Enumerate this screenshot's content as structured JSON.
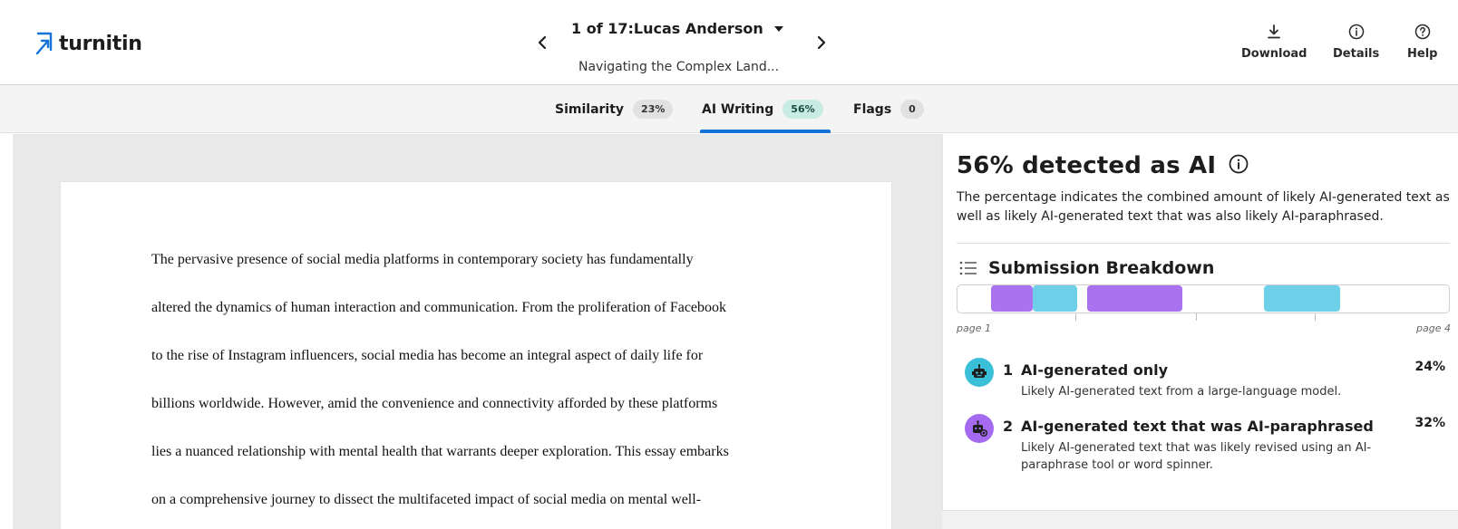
{
  "header": {
    "logo_text": "turnitin",
    "submission_title": "1 of 17:Lucas Anderson",
    "document_title": "Navigating the Complex Land...",
    "download_label": "Download",
    "details_label": "Details",
    "help_label": "Help",
    "brand_color": "#1572d6"
  },
  "tabs": [
    {
      "label": "Similarity",
      "badge": "23%"
    },
    {
      "label": "AI Writing",
      "badge": "56%",
      "active": true
    },
    {
      "label": "Flags",
      "badge": "0"
    }
  ],
  "document": {
    "lines": [
      "The pervasive presence of social media platforms in contemporary society has fundamentally",
      "altered the dynamics of human interaction and communication. From the proliferation of Facebook",
      "to the rise of Instagram influencers, social media has become an integral aspect of daily life for",
      "billions worldwide. However, amid the convenience and connectivity afforded by these platforms",
      "lies a nuanced relationship with mental health that warrants deeper exploration. This essay embarks",
      "on a comprehensive journey to dissect the multifaceted impact of social media on mental well-"
    ]
  },
  "panel": {
    "title": "56% detected as AI",
    "description": "The percentage indicates the combined amount of likely AI-generated text as well as likely AI-generated text that was also likely AI-paraphrased.",
    "breakdown_title": "Submission Breakdown",
    "page_start_label": "page 1",
    "page_end_label": "page 4",
    "categories": [
      {
        "number": "1",
        "title": "AI-generated only",
        "description": "Likely AI-generated text from a large-language model.",
        "percent": "24%",
        "color": "#3bbfd9"
      },
      {
        "number": "2",
        "title": "AI-generated text that was AI-paraphrased",
        "description": "Likely AI-generated text that was likely revised using an AI-paraphrase tool or word spinner.",
        "percent": "32%",
        "color": "#a46bf0"
      }
    ]
  }
}
